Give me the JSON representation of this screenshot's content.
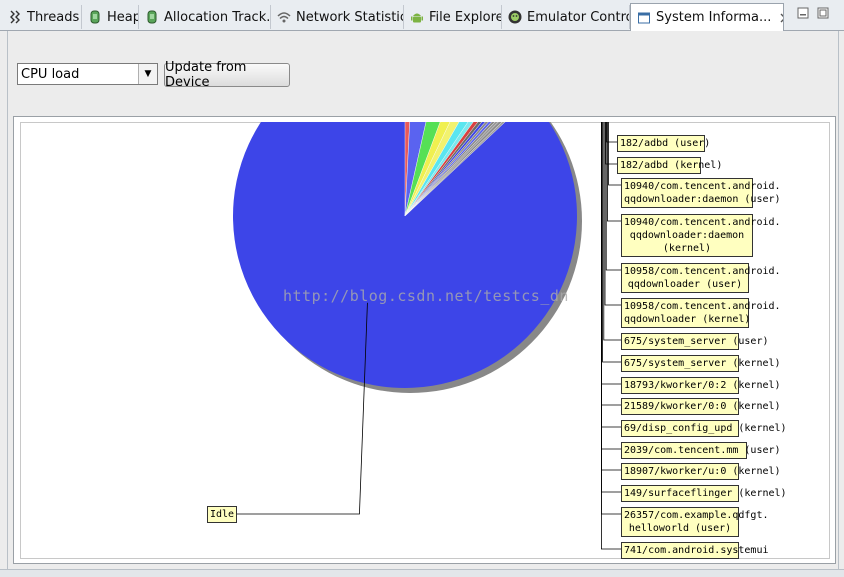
{
  "tabs": [
    {
      "label": "Threads",
      "icon": "threads-icon"
    },
    {
      "label": "Heap",
      "icon": "heap-icon"
    },
    {
      "label": "Allocation Track...",
      "icon": "allocation-icon"
    },
    {
      "label": "Network Statistics",
      "icon": "network-icon"
    },
    {
      "label": "File Explorer",
      "icon": "android-icon"
    },
    {
      "label": "Emulator Control",
      "icon": "emulator-icon"
    },
    {
      "label": "System Informa...",
      "icon": "system-info-icon",
      "active": true
    }
  ],
  "toolbar": {
    "dropdown_value": "CPU load",
    "update_button": "Update from Device"
  },
  "watermark": "http://blog.csdn.net/testcs_dn",
  "chart_data": {
    "type": "pie",
    "slices": [
      {
        "label": "Idle",
        "value": 87.0,
        "color": "#3d45e8"
      },
      {
        "label": "182/adbd (user)",
        "value": 0.8,
        "color": "#e85a5a"
      },
      {
        "label": "182/adbd (kernel)",
        "value": 2.7,
        "color": "#5a63f0"
      },
      {
        "label": "10940/com.tencent.android.\nqqdownloader:daemon (user)",
        "value": 2.2,
        "color": "#55e055"
      },
      {
        "label": "10940/com.tencent.android.\nqqdownloader:daemon\n(kernel)",
        "value": 1.4,
        "color": "#f0f050"
      },
      {
        "label": "10958/com.tencent.android.\nqqdownloader (user)",
        "value": 1.2,
        "color": "#f2f26e"
      },
      {
        "label": "10958/com.tencent.android.\nqqdownloader (kernel)",
        "value": 1.1,
        "color": "#5ae6f0"
      },
      {
        "label": "675/system_server (user)",
        "value": 0.6,
        "color": "#7ae8ee"
      },
      {
        "label": "675/system_server (kernel)",
        "value": 0.5,
        "color": "#d84040"
      },
      {
        "label": "18793/kworker/0:2 (kernel)",
        "value": 0.4,
        "color": "#6a6a6a"
      },
      {
        "label": "21589/kworker/0:0 (kernel)",
        "value": 0.35,
        "color": "#3d45e8"
      },
      {
        "label": "69/disp_config_upd (kernel)",
        "value": 0.3,
        "color": "#888888"
      },
      {
        "label": "2039/com.tencent.mm (user)",
        "value": 0.3,
        "color": "#5a63f0"
      },
      {
        "label": "18907/kworker/u:0 (kernel)",
        "value": 0.3,
        "color": "#888888"
      },
      {
        "label": "149/surfaceflinger (kernel)",
        "value": 0.3,
        "color": "#999999"
      },
      {
        "label": "26357/com.example.qdfgt.\nhelloworld (user)",
        "value": 0.3,
        "color": "#8a8a8a"
      },
      {
        "label": "741/com.android.systemui",
        "value": 0.25,
        "color": "#a0a0a0"
      }
    ]
  }
}
